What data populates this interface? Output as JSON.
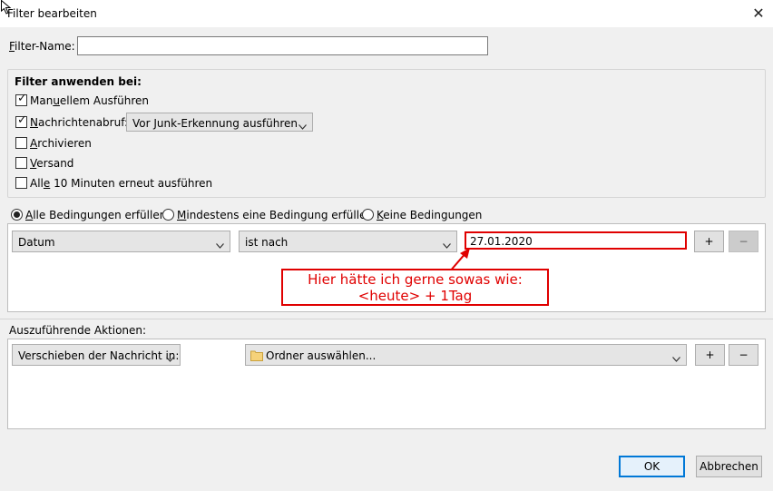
{
  "window": {
    "title": "Filter bearbeiten",
    "close_glyph": "✕"
  },
  "filter_name": {
    "label": "Filter-Name:",
    "value": ""
  },
  "apply_when": {
    "heading": "Filter anwenden bei:",
    "manual": {
      "label": "Manuellem Ausführen",
      "checked": true
    },
    "fetch": {
      "label": "Nachrichtenabruf:",
      "checked": true,
      "select_value": "Vor Junk-Erkennung ausführen"
    },
    "archive": {
      "label": "Archivieren",
      "checked": false
    },
    "send": {
      "label": "Versand",
      "checked": false
    },
    "periodic": {
      "label": "Alle 10 Minuten erneut ausführen",
      "checked": false
    }
  },
  "match_mode": {
    "all": "Alle Bedingungen erfüllen",
    "any": "Mindestens eine Bedingung erfüllen",
    "none": "Keine Bedingungen",
    "selected": "all"
  },
  "condition": {
    "field": "Datum",
    "operator": "ist nach",
    "value": "27.01.2020",
    "add_label": "+",
    "remove_label": "−"
  },
  "annotation": {
    "line1": "Hier hätte ich gerne sowas wie:",
    "line2": "<heute> + 1Tag",
    "color": "#e00000"
  },
  "actions": {
    "heading": "Auszuführende Aktionen:",
    "action": "Verschieben der Nachricht in:",
    "folder": "Ordner auswählen...",
    "add_label": "+",
    "remove_label": "−"
  },
  "footer": {
    "ok": "OK",
    "cancel": "Abbrechen"
  },
  "icons": {
    "folder": "folder-icon",
    "chevron": "chevron-down-icon",
    "check": "checkmark-icon"
  },
  "colors": {
    "accent": "#0078d7"
  }
}
